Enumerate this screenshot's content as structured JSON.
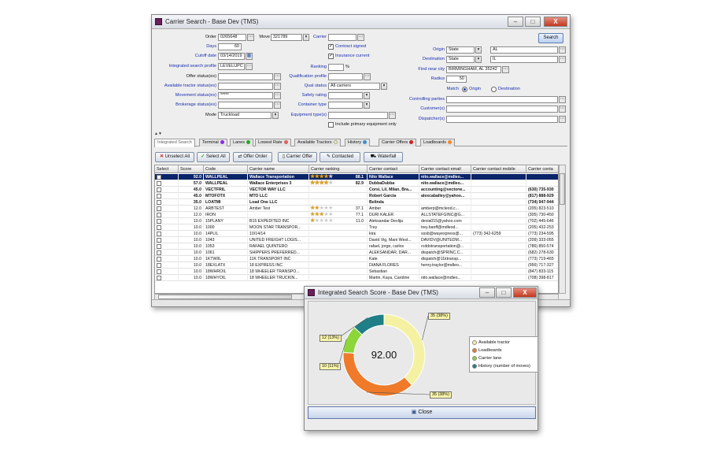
{
  "main_window": {
    "title": "Carrier Search - Base Dev (TMS)",
    "close_glyph": "X",
    "minimize_glyph": "–",
    "restore_glyph": "□"
  },
  "form": {
    "order_label": "Order",
    "order_value": "0265648",
    "move_label": "Move",
    "move_value": "321789",
    "carrier_label": "Carrier",
    "carrier_value": "",
    "days_label": "Days",
    "days_value": "60",
    "cutoff_label": "Cutoff date",
    "cutoff_value": "03/14/2019",
    "profile_label": "Integrated search profile",
    "profile_value": "LEVELUPC",
    "offer_status_label": "Offer status(es)",
    "avail_tractor_label": "Available tractor status(es)",
    "movement_status_label": "Movement status(es)",
    "movement_status_value": "*****",
    "brokerage_status_label": "Brokerage status(es)",
    "mode_label": "Mode",
    "mode_value": "Truckload",
    "contract_signed_label": "Contract signed",
    "insurance_label": "Insurance current",
    "ranking_label": "Ranking",
    "ranking_unit": "%",
    "qual_profile_label": "Qualification profile",
    "qual_status_label": "Qual status",
    "qual_status_value": "All carriers",
    "safety_label": "Safety rating",
    "container_label": "Container type",
    "equipment_label": "Equipment type(s)",
    "primary_equipment_label": "Include primary equipment only",
    "origin_label": "Origin",
    "origin_type": "State",
    "origin_value": "AL",
    "destination_label": "Destination",
    "destination_type": "State",
    "destination_value": "IL",
    "find_near_label": "Find near city",
    "find_near_value": "BIRMINGHAM, AL 35242",
    "radius_label": "Radius",
    "radius_value": "50",
    "match_label": "Match",
    "match_origin": "Origin",
    "match_destination": "Destination",
    "controlling_label": "Controlling parties",
    "customer_label": "Customer(s)",
    "dispatcher_label": "Dispatcher(s)",
    "search_button": "Search",
    "collapse_glyph": "▲▼"
  },
  "tabs": [
    {
      "label": "Integrated Search",
      "dot": ""
    },
    {
      "label": "Terminal",
      "dot": "#8a2be2"
    },
    {
      "label": "Lanes",
      "dot": "#22aa22"
    },
    {
      "label": "Lowest Rate",
      "dot": "#e06060"
    },
    {
      "label": "Available Tractors",
      "dot": ""
    },
    {
      "label": "History",
      "dot": "#3a8fd0"
    },
    {
      "label": "Carrier Offers",
      "dot": "#cc2222"
    },
    {
      "label": "Loadboards",
      "dot": "#f08a30"
    }
  ],
  "toolbar": {
    "unselect_all": "Unselect All",
    "select_all": "Select All",
    "offer_order": "Offer Order",
    "carrier_offer": "Carrier Offer",
    "contacted": "Contacted",
    "waterfall": "Waterfall"
  },
  "grid": {
    "headers": [
      "Select",
      "Score",
      "Code",
      "Carrier name",
      "Carrier ranking",
      "Carrier contact",
      "Carrier contact email",
      "Carrier contact mobile",
      "Carrier conta"
    ],
    "rows": [
      {
        "score": "92.0",
        "code": "WALLPEAL",
        "name": "Wallace Transportation",
        "stars": 4,
        "rank": "88.1",
        "contact": "Nito Wallace",
        "email": "nito.wallace@mdleo...",
        "mobile": "",
        "phone": "",
        "sel": true,
        "bold": true
      },
      {
        "score": "57.0",
        "code": "WALLPEAL",
        "name": "Wallace Enterprises 3",
        "stars": 4,
        "rank": "82.9",
        "contact": "DubbaDubba",
        "email": "nito.wallace@mdleo...",
        "mobile": "",
        "phone": "",
        "bold": true
      },
      {
        "score": "45.0",
        "code": "VECTFRIL",
        "name": "VECTOR WAY LLC",
        "stars": 0,
        "rank": "",
        "contact": "Corsi, Lil, Milan, Bra...",
        "email": "accounting@vectorw...",
        "mobile": "",
        "phone": "(630) 735-930",
        "bold": true
      },
      {
        "score": "45.0",
        "code": "MTOFOTX",
        "name": "MTO LLC",
        "stars": 0,
        "rank": "",
        "contact": "Robert Garcia",
        "email": "alexcaballey@yahoo...",
        "mobile": "",
        "phone": "(817) 888-929",
        "bold": true
      },
      {
        "score": "35.0",
        "code": "LOATMI",
        "name": "Load One LLC",
        "stars": 0,
        "rank": "",
        "contact": "Belinda",
        "email": "",
        "mobile": "",
        "phone": "(734) 947-944",
        "bold": true
      },
      {
        "score": "12.0",
        "code": "ARBTEST",
        "name": "Amber Test",
        "stars": 2,
        "rank": "37.1",
        "contact": "Amber",
        "email": "amberp@mcleod.c...",
        "mobile": "",
        "phone": "(205) 823-510"
      },
      {
        "score": "12.0",
        "code": "IRON",
        "name": "",
        "stars": 3,
        "rank": "77.1",
        "contact": "DURI KALER",
        "email": "ALLSTATEFGINC@G...",
        "mobile": "",
        "phone": "(305) 730-450"
      },
      {
        "score": "10.0",
        "code": "15PLANY",
        "name": "B15 EXPEDITED INC",
        "stars": 1,
        "rank": "11.0",
        "contact": "Aleksandar Devlija",
        "email": "devia015@yahoo.com",
        "mobile": "",
        "phone": "(702) 445-646"
      },
      {
        "score": "10.0",
        "code": "1000",
        "name": "MOON STAR TRANSPOR...",
        "stars": 0,
        "rank": "",
        "contact": "Trey",
        "email": "trey.banff@mdleod...",
        "mobile": "",
        "phone": "(205) 432-253"
      },
      {
        "score": "10.0",
        "code": "14PLIL",
        "name": "10/14/14",
        "stars": 0,
        "rank": "",
        "contact": "kira",
        "email": "sssb@wayexpress@...",
        "mobile": "(773) 342-6259",
        "phone": "(773) 234-595"
      },
      {
        "score": "10.0",
        "code": "1043",
        "name": "UNITED FREIGHT LOGIS...",
        "stars": 0,
        "rank": "",
        "contact": "David Vig, Mani West...",
        "email": "DAVIDV@UNITEDM...",
        "mobile": "",
        "phone": "(209) 333-055"
      },
      {
        "score": "10.0",
        "code": "1053",
        "name": "RAFAEL QUINTERO",
        "stars": 0,
        "rank": "",
        "contact": "rafael, jorge, carlos",
        "email": "rcddotransportation@...",
        "mobile": "",
        "phone": "(786) 850-574"
      },
      {
        "score": "10.0",
        "code": "1061",
        "name": "SHIPPERS PREFERRED...",
        "stars": 0,
        "rank": "",
        "contact": "ALEKSANDAR, DAR...",
        "email": "dispatch@SPRINC.C...",
        "mobile": "",
        "phone": "(682) 278-630"
      },
      {
        "score": "10.0",
        "code": "1KTWIIL",
        "name": "11K TRANSPORT INC",
        "stars": 0,
        "rank": "",
        "contact": "Kate",
        "email": "dispatch@11ktransp...",
        "mobile": "",
        "phone": "(773) 719-465"
      },
      {
        "score": "10.0",
        "code": "18EXLATX",
        "name": "18 EXPRESS INC",
        "stars": 0,
        "rank": "",
        "contact": "DIANA FLORES",
        "email": "henry.traylor@mdleo...",
        "mobile": "",
        "phone": "(956) 717-327"
      },
      {
        "score": "10.0",
        "code": "18WHROIL",
        "name": "18 WHEELER TRANSPO...",
        "stars": 0,
        "rank": "",
        "contact": "Sebastian",
        "email": "",
        "mobile": "",
        "phone": "(847) 833-115"
      },
      {
        "score": "10.0",
        "code": "18WHYOIL",
        "name": "18 WHEELER TRUCKIN...",
        "stars": 0,
        "rank": "",
        "contact": "Martin, Kaya, Caroline",
        "email": "nito.wallace@mdleo...",
        "mobile": "",
        "phone": "(708) 398-817"
      }
    ]
  },
  "popup": {
    "title": "Integrated Search Score - Base Dev (TMS)",
    "close_glyph": "X",
    "minimize_glyph": "–",
    "restore_glyph": "□",
    "close_button": "Close"
  },
  "chart_data": {
    "type": "pie",
    "title": "",
    "center_label": "92.00",
    "total": 92.0,
    "series": [
      {
        "name": "Available tractor",
        "value": 35,
        "label": "35 (38%)",
        "color": "#f4f2a2"
      },
      {
        "name": "Loadboards",
        "value": 35,
        "label": "35 (38%)",
        "color": "#ef7a2a"
      },
      {
        "name": "Carrier lane",
        "value": 10,
        "label": "10 (11%)",
        "color": "#8cd63a"
      },
      {
        "name": "History (number of moves)",
        "value": 12,
        "label": "12 (13%)",
        "color": "#1f7f86"
      }
    ]
  },
  "icons": {
    "app": "tms-app-icon",
    "picker": "picker-icon",
    "calendar": "calendar-icon",
    "dropdown": "chevron-down-icon"
  }
}
